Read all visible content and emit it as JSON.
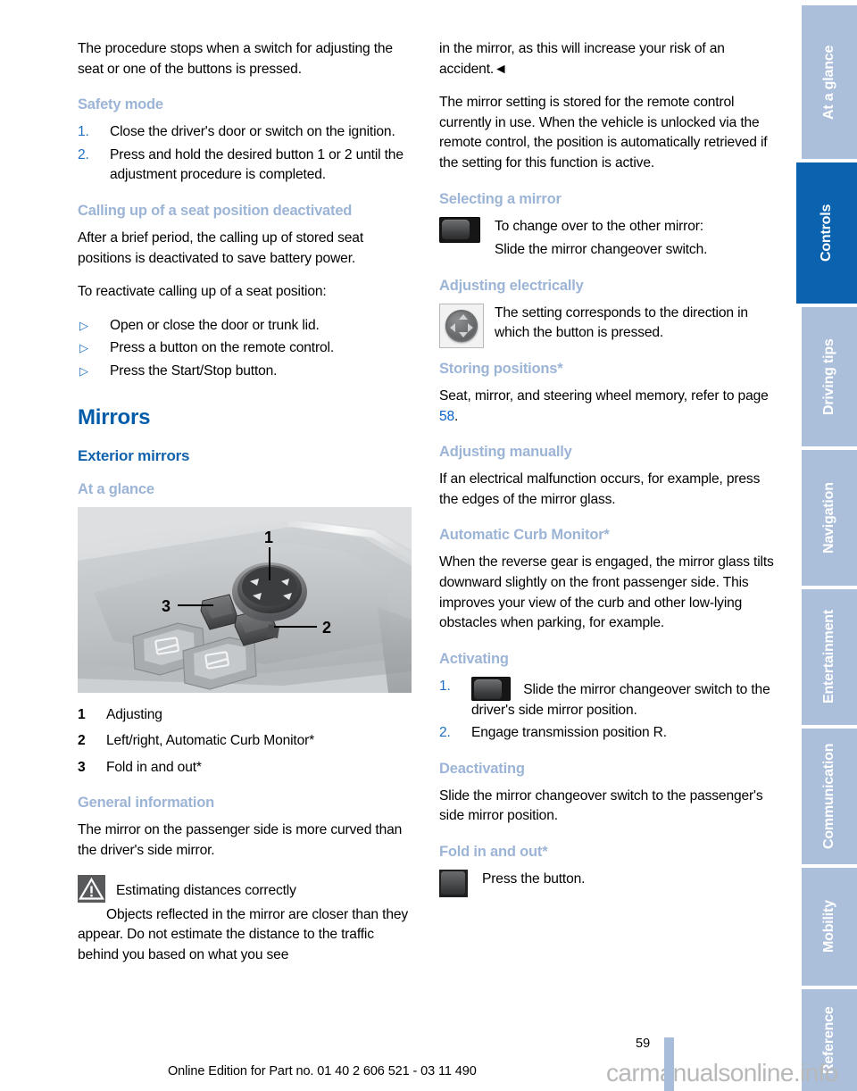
{
  "document": {
    "page_number": "59",
    "edition_line": "Online Edition for Part no. 01 40 2 606 521 - 03 11 490",
    "watermark": "carmanualsonline.info",
    "accent_blue": "#005ca9",
    "heading_light_blue": "#9cb4d6",
    "tab_inactive": "#abbfdb",
    "tab_active": "#0b62ae"
  },
  "sidebar": {
    "tabs": [
      {
        "label": "At a glance",
        "active": false
      },
      {
        "label": "Controls",
        "active": true
      },
      {
        "label": "Driving tips",
        "active": false
      },
      {
        "label": "Navigation",
        "active": false
      },
      {
        "label": "Entertainment",
        "active": false
      },
      {
        "label": "Communication",
        "active": false
      },
      {
        "label": "Mobility",
        "active": false
      },
      {
        "label": "Reference",
        "active": false
      }
    ]
  },
  "left_column": {
    "intro_paragraph": "The procedure stops when a switch for adjusting the seat or one of the buttons is pressed.",
    "safety_mode": {
      "heading": "Safety mode",
      "steps": [
        {
          "marker": "1.",
          "text": "Close the driver's door or switch on the ignition."
        },
        {
          "marker": "2.",
          "text": "Press and hold the desired button 1 or 2 until the adjustment procedure is completed."
        }
      ]
    },
    "calling_up": {
      "heading": "Calling up of a seat position deactivated",
      "paragraph_1": "After a brief period, the calling up of stored seat positions is deactivated to save battery power.",
      "paragraph_2": "To reactivate calling up of a seat position:",
      "bullets": [
        {
          "marker": "▷",
          "text": "Open or close the door or trunk lid."
        },
        {
          "marker": "▷",
          "text": "Press a button on the remote control."
        },
        {
          "marker": "▷",
          "text": "Press the Start/Stop button."
        }
      ]
    },
    "mirrors": {
      "heading": "Mirrors",
      "subheading": "Exterior mirrors",
      "at_a_glance_heading": "At a glance",
      "figure_caption_numbers": [
        "1",
        "2",
        "3"
      ],
      "figure_alt": "Driver's door control panel showing mirror adjustment knob and buttons",
      "legend": [
        {
          "marker": "1",
          "text": "Adjusting"
        },
        {
          "marker": "2",
          "text": "Left/right, Automatic Curb Monitor*"
        },
        {
          "marker": "3",
          "text": "Fold in and out*"
        }
      ]
    },
    "general_information": {
      "heading": "General information",
      "paragraph": "The mirror on the passenger side is more curved than the driver's side mirror.",
      "warning": {
        "icon": "warning-triangle-icon",
        "title": "Estimating distances correctly",
        "body": "Objects reflected in the mirror are closer than they appear. Do not estimate the distance to the traffic behind you based on what you see"
      }
    }
  },
  "right_column": {
    "warning_continuation": {
      "text": "in the mirror, as this will increase your risk of an accident.",
      "end_marker": "◄"
    },
    "stored_setting_paragraph": "The mirror setting is stored for the remote control currently in use. When the vehicle is unlocked via the remote control, the position is automatically retrieved if the setting for this function is active.",
    "selecting_a_mirror": {
      "heading": "Selecting a mirror",
      "icon": "mirror-changeover-switch-icon",
      "line_1": "To change over to the other mirror:",
      "line_2": "Slide the mirror changeover switch."
    },
    "adjusting_electrically": {
      "heading": "Adjusting electrically",
      "icon": "mirror-adjust-knob-icon",
      "text": "The setting corresponds to the direction in which the button is pressed."
    },
    "storing_positions": {
      "heading": "Storing positions*",
      "text_before": "Seat, mirror, and steering wheel memory, refer to page ",
      "page_ref": "58",
      "text_after": "."
    },
    "adjusting_manually": {
      "heading": "Adjusting manually",
      "text": "If an electrical malfunction occurs, for example, press the edges of the mirror glass."
    },
    "automatic_curb_monitor": {
      "heading": "Automatic Curb Monitor*",
      "text": "When the reverse gear is engaged, the mirror glass tilts downward slightly on the front passenger side. This improves your view of the curb and other low-lying obstacles when parking, for example."
    },
    "activating": {
      "heading": "Activating",
      "steps": [
        {
          "marker": "1.",
          "icon": "mirror-changeover-switch-icon",
          "text": "Slide the mirror changeover switch to the driver's side mirror position."
        },
        {
          "marker": "2.",
          "icon": "",
          "text": "Engage transmission position R."
        }
      ]
    },
    "deactivating": {
      "heading": "Deactivating",
      "text": "Slide the mirror changeover switch to the passenger's side mirror position."
    },
    "fold_in_and_out": {
      "heading": "Fold in and out*",
      "icon": "fold-mirror-button-icon",
      "text": "Press the button."
    }
  }
}
